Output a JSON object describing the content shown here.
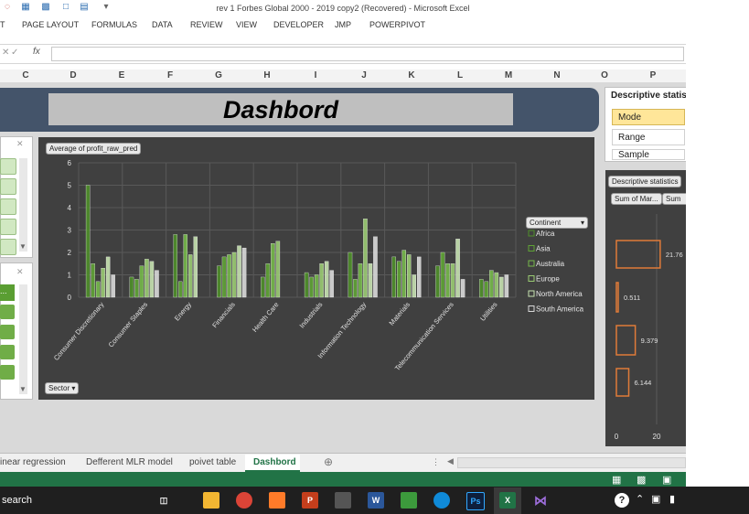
{
  "window": {
    "title": "rev 1 Forbes Global 2000 - 2019 copy2 (Recovered) - Microsoft Excel"
  },
  "ribbon": {
    "tabs": [
      "T",
      "PAGE LAYOUT",
      "FORMULAS",
      "DATA",
      "REVIEW",
      "VIEW",
      "DEVELOPER",
      "JMP",
      "POWERPIVOT"
    ]
  },
  "formula_bar": {
    "fx": "fx",
    "value": ""
  },
  "columns": [
    "C",
    "D",
    "E",
    "F",
    "G",
    "H",
    "I",
    "J",
    "K",
    "L",
    "M",
    "N",
    "O",
    "P"
  ],
  "dashboard": {
    "title": "Dashbord"
  },
  "slicer1": {
    "clear_icon": "filter-clear-icon"
  },
  "slicer2": {
    "top_item": "..."
  },
  "chart_data": {
    "type": "bar",
    "title": "Average of profit_raw_pred",
    "axis_field_button": "Sector",
    "legend_title": "Continent",
    "legend_position": "right",
    "ylim": [
      0,
      6
    ],
    "yticks": [
      "0",
      "1",
      "2",
      "3",
      "4",
      "5",
      "6"
    ],
    "categories": [
      "Consumer Discretionary",
      "Consumer Staples",
      "Energy",
      "Financials",
      "Health Care",
      "Industrials",
      "Information Technology",
      "Materials",
      "Telecommunication Services",
      "Utilities"
    ],
    "series": [
      {
        "name": "Africa",
        "color": "#4f8f2a",
        "values": [
          5.0,
          0.9,
          2.8,
          1.4,
          0.9,
          1.1,
          2.0,
          1.8,
          1.4,
          0.8
        ]
      },
      {
        "name": "Asia",
        "color": "#5fa335",
        "values": [
          1.5,
          0.8,
          0.7,
          1.8,
          1.5,
          0.9,
          0.8,
          1.6,
          2.0,
          0.7
        ]
      },
      {
        "name": "Australia",
        "color": "#76b84a",
        "values": [
          0.7,
          1.4,
          2.8,
          1.9,
          2.4,
          1.0,
          1.5,
          2.1,
          1.5,
          1.2
        ]
      },
      {
        "name": "Europe",
        "color": "#9acb72",
        "values": [
          1.3,
          1.7,
          1.9,
          2.0,
          2.5,
          1.5,
          3.5,
          1.9,
          1.5,
          1.1
        ]
      },
      {
        "name": "North America",
        "color": "#c6e2b0",
        "values": [
          1.8,
          1.6,
          2.7,
          2.3,
          0.0,
          1.6,
          1.5,
          1.0,
          2.6,
          0.9
        ]
      },
      {
        "name": "South America",
        "color": "#d9d9d9",
        "values": [
          1.0,
          1.2,
          0.0,
          2.2,
          0.0,
          1.2,
          2.7,
          1.8,
          0.8,
          1.0
        ]
      }
    ]
  },
  "stats_slicer": {
    "header": "Descriptive statis",
    "options": [
      "Mode",
      "Range",
      "Sample Variance"
    ],
    "selected": "Mode"
  },
  "stats_chart": {
    "title": "Descriptive statistics",
    "buttons": [
      "Sum of Mar...",
      "Sum o"
    ],
    "labels": [
      "21.76",
      "0.511",
      "9.379",
      "6.144"
    ],
    "xticks": [
      "0",
      "20"
    ],
    "bar_color": "#e07b39"
  },
  "sheet_tabs": [
    "inear regression",
    "Defferent MLR model",
    "poivet table",
    "Dashbord"
  ],
  "active_sheet": "Dashbord",
  "taskbar": {
    "search": "search"
  }
}
